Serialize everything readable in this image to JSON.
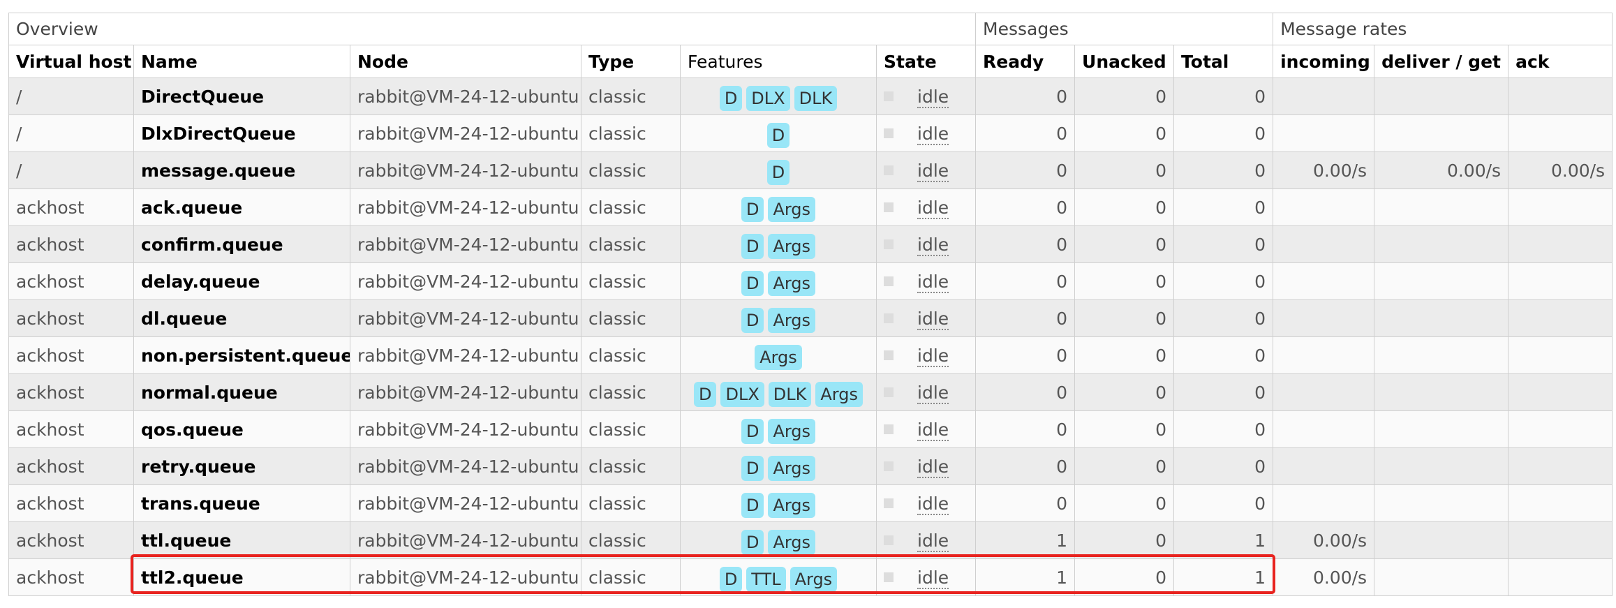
{
  "header": {
    "groups": {
      "overview": "Overview",
      "messages": "Messages",
      "message_rates": "Message rates"
    },
    "columns": {
      "vhost": "Virtual host",
      "name": "Name",
      "node": "Node",
      "type": "Type",
      "features": "Features",
      "state": "State",
      "ready": "Ready",
      "unacked": "Unacked",
      "total": "Total",
      "incoming": "incoming",
      "deliver_get": "deliver / get",
      "ack": "ack"
    }
  },
  "rows": [
    {
      "vhost": "/",
      "name": "DirectQueue",
      "node": "rabbit@VM-24-12-ubuntu",
      "type": "classic",
      "features": [
        "D",
        "DLX",
        "DLK"
      ],
      "state": "idle",
      "ready": "0",
      "unacked": "0",
      "total": "0",
      "incoming": "",
      "deliver_get": "",
      "ack": ""
    },
    {
      "vhost": "/",
      "name": "DlxDirectQueue",
      "node": "rabbit@VM-24-12-ubuntu",
      "type": "classic",
      "features": [
        "D"
      ],
      "state": "idle",
      "ready": "0",
      "unacked": "0",
      "total": "0",
      "incoming": "",
      "deliver_get": "",
      "ack": ""
    },
    {
      "vhost": "/",
      "name": "message.queue",
      "node": "rabbit@VM-24-12-ubuntu",
      "type": "classic",
      "features": [
        "D"
      ],
      "state": "idle",
      "ready": "0",
      "unacked": "0",
      "total": "0",
      "incoming": "0.00/s",
      "deliver_get": "0.00/s",
      "ack": "0.00/s"
    },
    {
      "vhost": "ackhost",
      "name": "ack.queue",
      "node": "rabbit@VM-24-12-ubuntu",
      "type": "classic",
      "features": [
        "D",
        "Args"
      ],
      "state": "idle",
      "ready": "0",
      "unacked": "0",
      "total": "0",
      "incoming": "",
      "deliver_get": "",
      "ack": ""
    },
    {
      "vhost": "ackhost",
      "name": "confirm.queue",
      "node": "rabbit@VM-24-12-ubuntu",
      "type": "classic",
      "features": [
        "D",
        "Args"
      ],
      "state": "idle",
      "ready": "0",
      "unacked": "0",
      "total": "0",
      "incoming": "",
      "deliver_get": "",
      "ack": ""
    },
    {
      "vhost": "ackhost",
      "name": "delay.queue",
      "node": "rabbit@VM-24-12-ubuntu",
      "type": "classic",
      "features": [
        "D",
        "Args"
      ],
      "state": "idle",
      "ready": "0",
      "unacked": "0",
      "total": "0",
      "incoming": "",
      "deliver_get": "",
      "ack": ""
    },
    {
      "vhost": "ackhost",
      "name": "dl.queue",
      "node": "rabbit@VM-24-12-ubuntu",
      "type": "classic",
      "features": [
        "D",
        "Args"
      ],
      "state": "idle",
      "ready": "0",
      "unacked": "0",
      "total": "0",
      "incoming": "",
      "deliver_get": "",
      "ack": ""
    },
    {
      "vhost": "ackhost",
      "name": "non.persistent.queue",
      "node": "rabbit@VM-24-12-ubuntu",
      "type": "classic",
      "features": [
        "Args"
      ],
      "state": "idle",
      "ready": "0",
      "unacked": "0",
      "total": "0",
      "incoming": "",
      "deliver_get": "",
      "ack": ""
    },
    {
      "vhost": "ackhost",
      "name": "normal.queue",
      "node": "rabbit@VM-24-12-ubuntu",
      "type": "classic",
      "features": [
        "D",
        "DLX",
        "DLK",
        "Args"
      ],
      "state": "idle",
      "ready": "0",
      "unacked": "0",
      "total": "0",
      "incoming": "",
      "deliver_get": "",
      "ack": ""
    },
    {
      "vhost": "ackhost",
      "name": "qos.queue",
      "node": "rabbit@VM-24-12-ubuntu",
      "type": "classic",
      "features": [
        "D",
        "Args"
      ],
      "state": "idle",
      "ready": "0",
      "unacked": "0",
      "total": "0",
      "incoming": "",
      "deliver_get": "",
      "ack": ""
    },
    {
      "vhost": "ackhost",
      "name": "retry.queue",
      "node": "rabbit@VM-24-12-ubuntu",
      "type": "classic",
      "features": [
        "D",
        "Args"
      ],
      "state": "idle",
      "ready": "0",
      "unacked": "0",
      "total": "0",
      "incoming": "",
      "deliver_get": "",
      "ack": ""
    },
    {
      "vhost": "ackhost",
      "name": "trans.queue",
      "node": "rabbit@VM-24-12-ubuntu",
      "type": "classic",
      "features": [
        "D",
        "Args"
      ],
      "state": "idle",
      "ready": "0",
      "unacked": "0",
      "total": "0",
      "incoming": "",
      "deliver_get": "",
      "ack": ""
    },
    {
      "vhost": "ackhost",
      "name": "ttl.queue",
      "node": "rabbit@VM-24-12-ubuntu",
      "type": "classic",
      "features": [
        "D",
        "Args"
      ],
      "state": "idle",
      "ready": "1",
      "unacked": "0",
      "total": "1",
      "incoming": "0.00/s",
      "deliver_get": "",
      "ack": ""
    },
    {
      "vhost": "ackhost",
      "name": "ttl2.queue",
      "node": "rabbit@VM-24-12-ubuntu",
      "type": "classic",
      "features": [
        "D",
        "TTL",
        "Args"
      ],
      "state": "idle",
      "ready": "1",
      "unacked": "0",
      "total": "1",
      "incoming": "0.00/s",
      "deliver_get": "",
      "ack": ""
    }
  ],
  "highlight": {
    "row_name": "ttl2.queue",
    "color": "#e8231f"
  },
  "colors": {
    "badge": "#99e6f7",
    "row_odd": "#ececec",
    "row_even": "#fafafa",
    "border": "#cfcfcf"
  }
}
